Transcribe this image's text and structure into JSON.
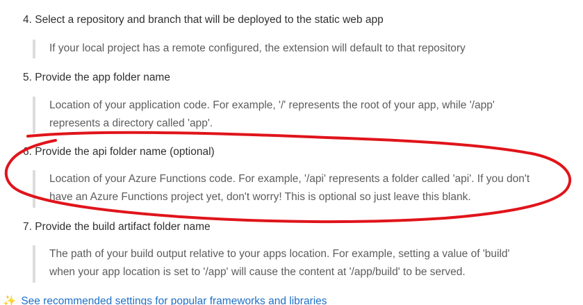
{
  "steps": [
    {
      "label": "4. Select a repository and branch that will be deployed to the static web app",
      "note_lines": [
        "If your local project has a remote configured, the extension will default to that repository"
      ]
    },
    {
      "label": "5. Provide the app folder name",
      "note_lines": [
        "Location of your application code. For example, '/' represents the root of your app, while '/app'",
        "represents a directory called 'app'."
      ]
    },
    {
      "label": "6. Provide the api folder name (optional)",
      "note_lines": [
        "Location of your Azure Functions code. For example, '/api' represents a folder called 'api'. If you don't",
        "have an Azure Functions project yet, don't worry! This is optional so just leave this blank."
      ]
    },
    {
      "label": "7. Provide the build artifact folder name",
      "note_lines": [
        "The path of your build output relative to your apps location. For example, setting a value of 'build'",
        "when your app location is set to '/app' will cause the content at '/app/build' to be served."
      ]
    }
  ],
  "footer_link": {
    "icon": "sparkles-icon",
    "label": "See recommended settings for popular frameworks and libraries"
  },
  "colors": {
    "annotation": "#e0141b",
    "link": "#1f6fc5",
    "quote_bar": "#dcdcdc",
    "quote_text": "#5c5c5c"
  }
}
